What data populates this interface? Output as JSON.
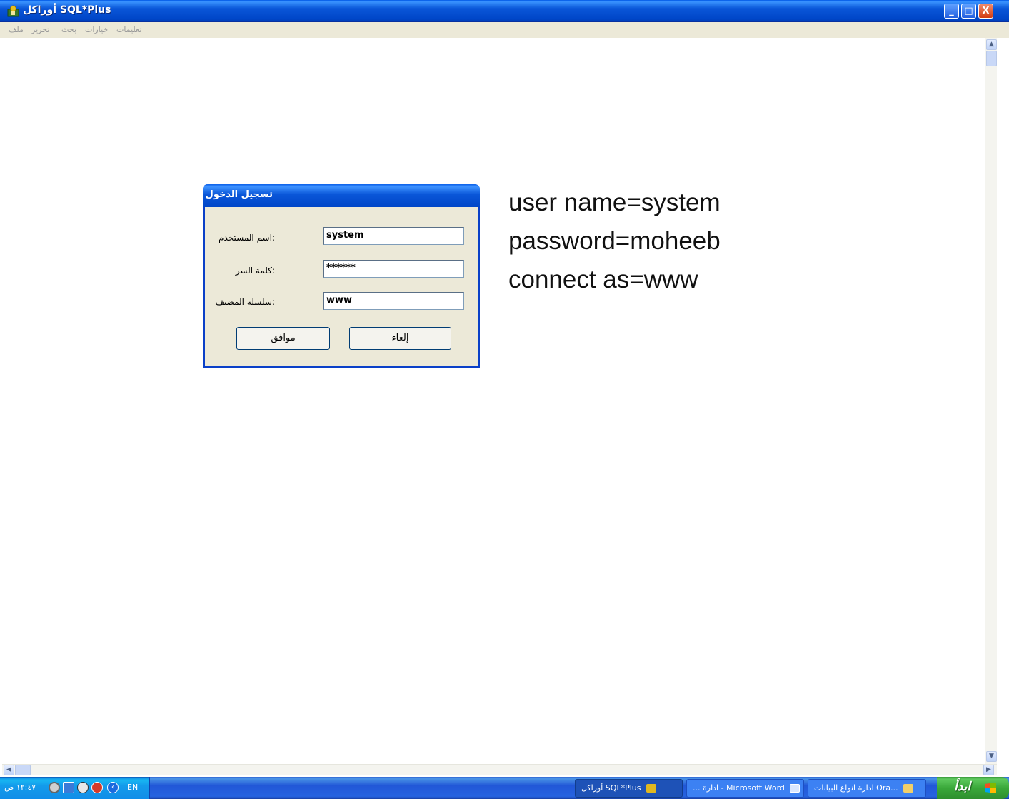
{
  "window": {
    "title": "أوراكل SQL*Plus",
    "buttons": {
      "minimize": "_",
      "maximize": "□",
      "close": "X"
    }
  },
  "menu": {
    "items": [
      "ملف",
      "تحرير",
      "بحث",
      "خيارات",
      "تعليمات"
    ]
  },
  "dialog": {
    "title": "تسجيل الدخول",
    "user_label": ":اسم المستخدم",
    "user_value": "system",
    "password_label": ":كلمة السر",
    "password_value": "******",
    "host_label": ":سلسلة المضيف",
    "host_value": "www",
    "ok_label": "موافق",
    "cancel_label": "إلغاء"
  },
  "notes": [
    "user name=system",
    "password=moheeb",
    "connect as=www"
  ],
  "taskbar": {
    "start_label": "ابدأ",
    "tasks": [
      "ادارة انواع البيانات Ora...",
      "... ادارة - Microsoft Word",
      "أوراكل SQL*Plus"
    ],
    "language": "EN",
    "clock": "١٢:٤٧ ص"
  },
  "colors": {
    "title_bar": "#0a56d8",
    "dialog_bg": "#ece9d8",
    "taskbar": "#2157d7",
    "start_button": "#3aa83a"
  }
}
